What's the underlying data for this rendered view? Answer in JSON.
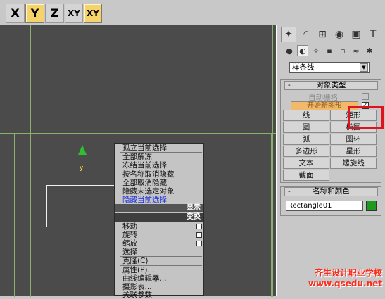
{
  "toolbar": {
    "buttons": [
      {
        "label": "X",
        "active": false
      },
      {
        "label": "Y",
        "active": true
      },
      {
        "label": "Z",
        "active": false
      },
      {
        "label": "XY",
        "active": false
      },
      {
        "label": "XY",
        "active": true
      }
    ]
  },
  "viewport": {
    "gizmo_label": "y"
  },
  "quad_menu": {
    "display_items": [
      "孤立当前选择",
      "全部解冻",
      "冻结当前选择",
      "按名称取消隐藏",
      "全部取消隐藏",
      "隐藏未选定对象",
      "隐藏当前选择"
    ],
    "display_header": "显示",
    "transform_header": "变换",
    "transform_items": [
      "移动",
      "旋转",
      "缩放",
      "选择",
      "克隆(C)",
      "属性(P)...",
      "曲线编辑器...",
      "摄影表...",
      "关联参数"
    ]
  },
  "command_panel": {
    "tab_icons": [
      "create-tab-icon",
      "modify-tab-icon",
      "hierarchy-tab-icon",
      "motion-tab-icon",
      "display-tab-icon",
      "utilities-tab-icon"
    ],
    "subtab_icons": [
      "geometry-icon",
      "shapes-icon",
      "lights-icon",
      "cameras-icon",
      "helpers-icon",
      "spacewarps-icon",
      "systems-icon"
    ],
    "category_dropdown": "样条线",
    "object_type": {
      "header": "对象类型",
      "autogrid_label": "自动栅格",
      "start_new_shape_label": "开始新图形",
      "start_new_shape_checked": true,
      "buttons": [
        "线",
        "矩形",
        "圆",
        "椭圆",
        "弧",
        "圆环",
        "多边形",
        "星形",
        "文本",
        "螺旋线",
        "截面"
      ]
    },
    "name_color": {
      "header": "名称和颜色",
      "object_name": "Rectangle01",
      "color": "#1e9a1e"
    }
  },
  "watermark": {
    "line1": "齐生设计职业学校",
    "line2": "www.qsedu.net"
  },
  "colors": {
    "highlight": "#e0121b",
    "active_button": "#f6d36a"
  }
}
